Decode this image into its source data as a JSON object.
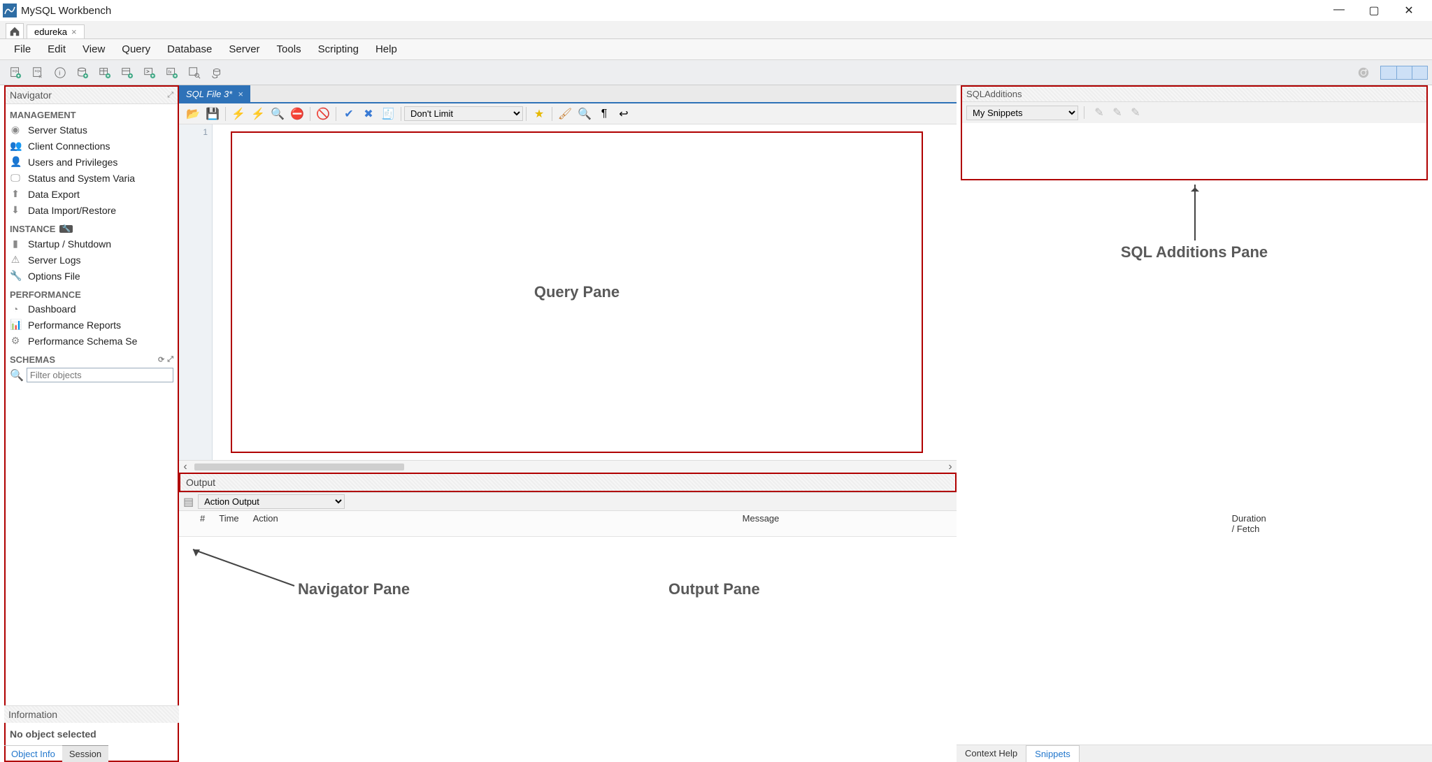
{
  "window": {
    "title": "MySQL Workbench"
  },
  "connection_tab": {
    "label": "edureka"
  },
  "menu": [
    "File",
    "Edit",
    "View",
    "Query",
    "Database",
    "Server",
    "Tools",
    "Scripting",
    "Help"
  ],
  "navigator": {
    "title": "Navigator",
    "management": {
      "heading": "MANAGEMENT",
      "items": [
        "Server Status",
        "Client Connections",
        "Users and Privileges",
        "Status and System Varia",
        "Data Export",
        "Data Import/Restore"
      ]
    },
    "instance": {
      "heading": "INSTANCE",
      "items": [
        "Startup / Shutdown",
        "Server Logs",
        "Options File"
      ]
    },
    "performance": {
      "heading": "PERFORMANCE",
      "items": [
        "Dashboard",
        "Performance Reports",
        "Performance Schema Se"
      ]
    },
    "schemas": {
      "heading": "SCHEMAS",
      "filter_placeholder": "Filter objects"
    },
    "information": {
      "heading": "Information",
      "body": "No object selected",
      "tabs": [
        "Object Info",
        "Session"
      ],
      "active_tab": 1
    }
  },
  "sql_tab": {
    "label": "SQL File 3*"
  },
  "sql_toolbar": {
    "limit_options": [
      "Don't Limit"
    ],
    "limit_selected": "Don't Limit"
  },
  "editor": {
    "first_line_number": "1"
  },
  "annotations": {
    "query_pane": "Query Pane",
    "sql_additions_pane": "SQL Additions Pane",
    "navigator_pane": "Navigator Pane",
    "output_pane": "Output Pane"
  },
  "sql_additions": {
    "title": "SQLAdditions",
    "dropdown": "My Snippets",
    "tabs": [
      "Context Help",
      "Snippets"
    ],
    "active_tab": 1
  },
  "output": {
    "title": "Output",
    "dropdown": "Action Output",
    "columns": {
      "idx": "#",
      "time": "Time",
      "action": "Action",
      "message": "Message",
      "duration": "Duration / Fetch"
    }
  }
}
